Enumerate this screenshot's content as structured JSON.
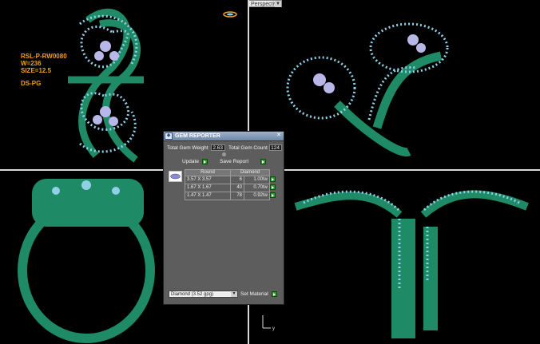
{
  "viewport": {
    "projection_label": "Perspective",
    "info_lines": [
      "RSL-P-RW0080",
      "W=236",
      "SIZE=12.5"
    ],
    "info_tag": "DS-PG",
    "axis_label": "y"
  },
  "gem_reporter": {
    "title": "GEM REPORTER",
    "total_weight_label": "Total Gem Weight",
    "total_weight_value": "2.63",
    "total_count_label": "Total Gem Count",
    "total_count_value": "124",
    "update_label": "Update",
    "save_report_label": "Save Report",
    "table_headers": [
      "Round",
      "Diamond"
    ],
    "rows": [
      {
        "size": "3.57 X 3.57",
        "count": "6",
        "weight": "1.00tw"
      },
      {
        "size": "1.67 X 1.67",
        "count": "40",
        "weight": "0.70tw"
      },
      {
        "size": "1.47 X 1.47",
        "count": "78",
        "weight": "0.92tw"
      }
    ],
    "material_value": "Diamond    (3.52 gpg)",
    "set_material_label": "Set Material"
  },
  "colors": {
    "metal": "#1f8a66",
    "gem": "#8fd0e6",
    "label": "#f0a020"
  }
}
